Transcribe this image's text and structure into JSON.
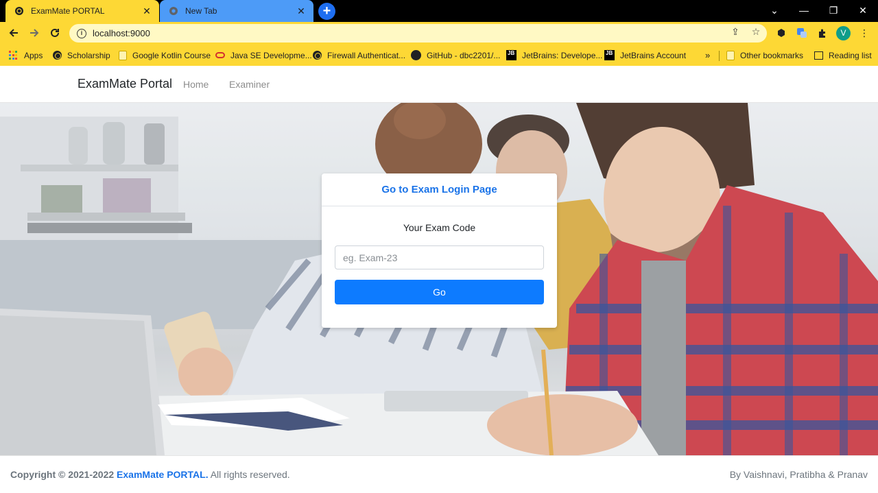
{
  "browser": {
    "tabs": [
      {
        "title": "ExamMate PORTAL",
        "active": true
      },
      {
        "title": "New Tab",
        "active": false
      }
    ],
    "url": "localhost:9000",
    "profile_initial": "V",
    "bookmarks": [
      {
        "label": "Apps",
        "icon": "apps-grid-icon"
      },
      {
        "label": "Scholarship",
        "icon": "globe-icon"
      },
      {
        "label": "Google Kotlin Course",
        "icon": "folder-icon"
      },
      {
        "label": "Java SE Developme...",
        "icon": "oracle-icon"
      },
      {
        "label": "Firewall Authenticat...",
        "icon": "globe-icon"
      },
      {
        "label": "GitHub - dbc2201/...",
        "icon": "github-icon"
      },
      {
        "label": "JetBrains: Develope...",
        "icon": "jetbrains-icon"
      },
      {
        "label": "JetBrains Account",
        "icon": "jetbrains-icon"
      }
    ],
    "overflow": "»",
    "other_bookmarks": "Other bookmarks",
    "reading_list": "Reading list"
  },
  "navbar": {
    "brand": "ExamMate Portal",
    "links": [
      "Home",
      "Examiner"
    ]
  },
  "card": {
    "title": "Go to Exam Login Page",
    "label": "Your Exam Code",
    "input_value": "",
    "input_placeholder": "eg. Exam-23",
    "button_label": "Go"
  },
  "footer": {
    "copyright_prefix": "Copyright © 2021-2022",
    "brand": "ExamMate PORTAL.",
    "rights": "All rights reserved.",
    "credits": "By Vaishnavi, Pratibha & Pranav"
  },
  "colors": {
    "chrome_yellow": "#fdd835",
    "accent_blue": "#1a73e8",
    "button_blue": "#0d7bff"
  }
}
